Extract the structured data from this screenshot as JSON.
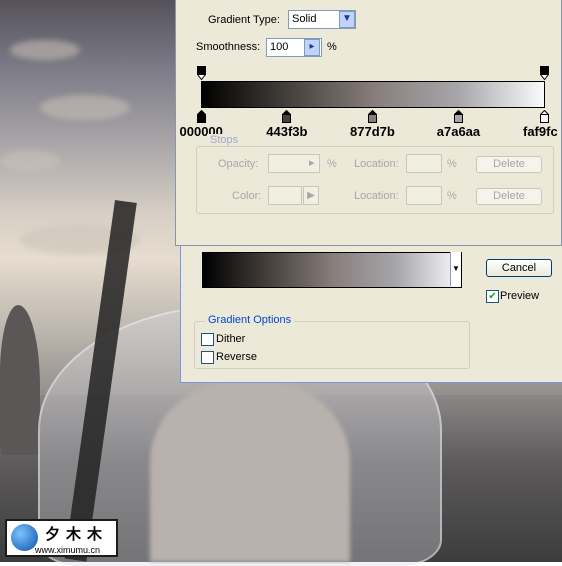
{
  "gradient_editor": {
    "type_label": "Gradient Type:",
    "type_value": "Solid",
    "smoothness_label": "Smoothness:",
    "smoothness_value": "100",
    "smoothness_unit": "%",
    "color_stops": [
      {
        "label": "000000",
        "color": "#000000",
        "location": 0
      },
      {
        "label": "443f3b",
        "color": "#443f3b",
        "location": 25
      },
      {
        "label": "877d7b",
        "color": "#877d7b",
        "location": 50
      },
      {
        "label": "a7a6aa",
        "color": "#a7a6aa",
        "location": 75
      },
      {
        "label": "faf9fc",
        "color": "#faf9fc",
        "location": 100
      }
    ],
    "stops_group": {
      "title": "Stops",
      "opacity_label": "Opacity:",
      "opacity_unit": "%",
      "location_label": "Location:",
      "location_unit": "%",
      "delete_label": "Delete",
      "color_label": "Color:",
      "location2_label": "Location:",
      "location2_unit": "%",
      "delete2_label": "Delete"
    }
  },
  "gradient_tool_options": {
    "cancel_label": "Cancel",
    "preview_label": "Preview",
    "preview_checked": true,
    "options_group_title": "Gradient Options",
    "dither_label": "Dither",
    "reverse_label": "Reverse"
  },
  "logo": {
    "text": "夕木木",
    "url": "www.ximumu.cn"
  },
  "colors": {
    "window_bg": "#ece9d8",
    "group_title": "#0046d5",
    "field_border": "#7f9db9"
  }
}
